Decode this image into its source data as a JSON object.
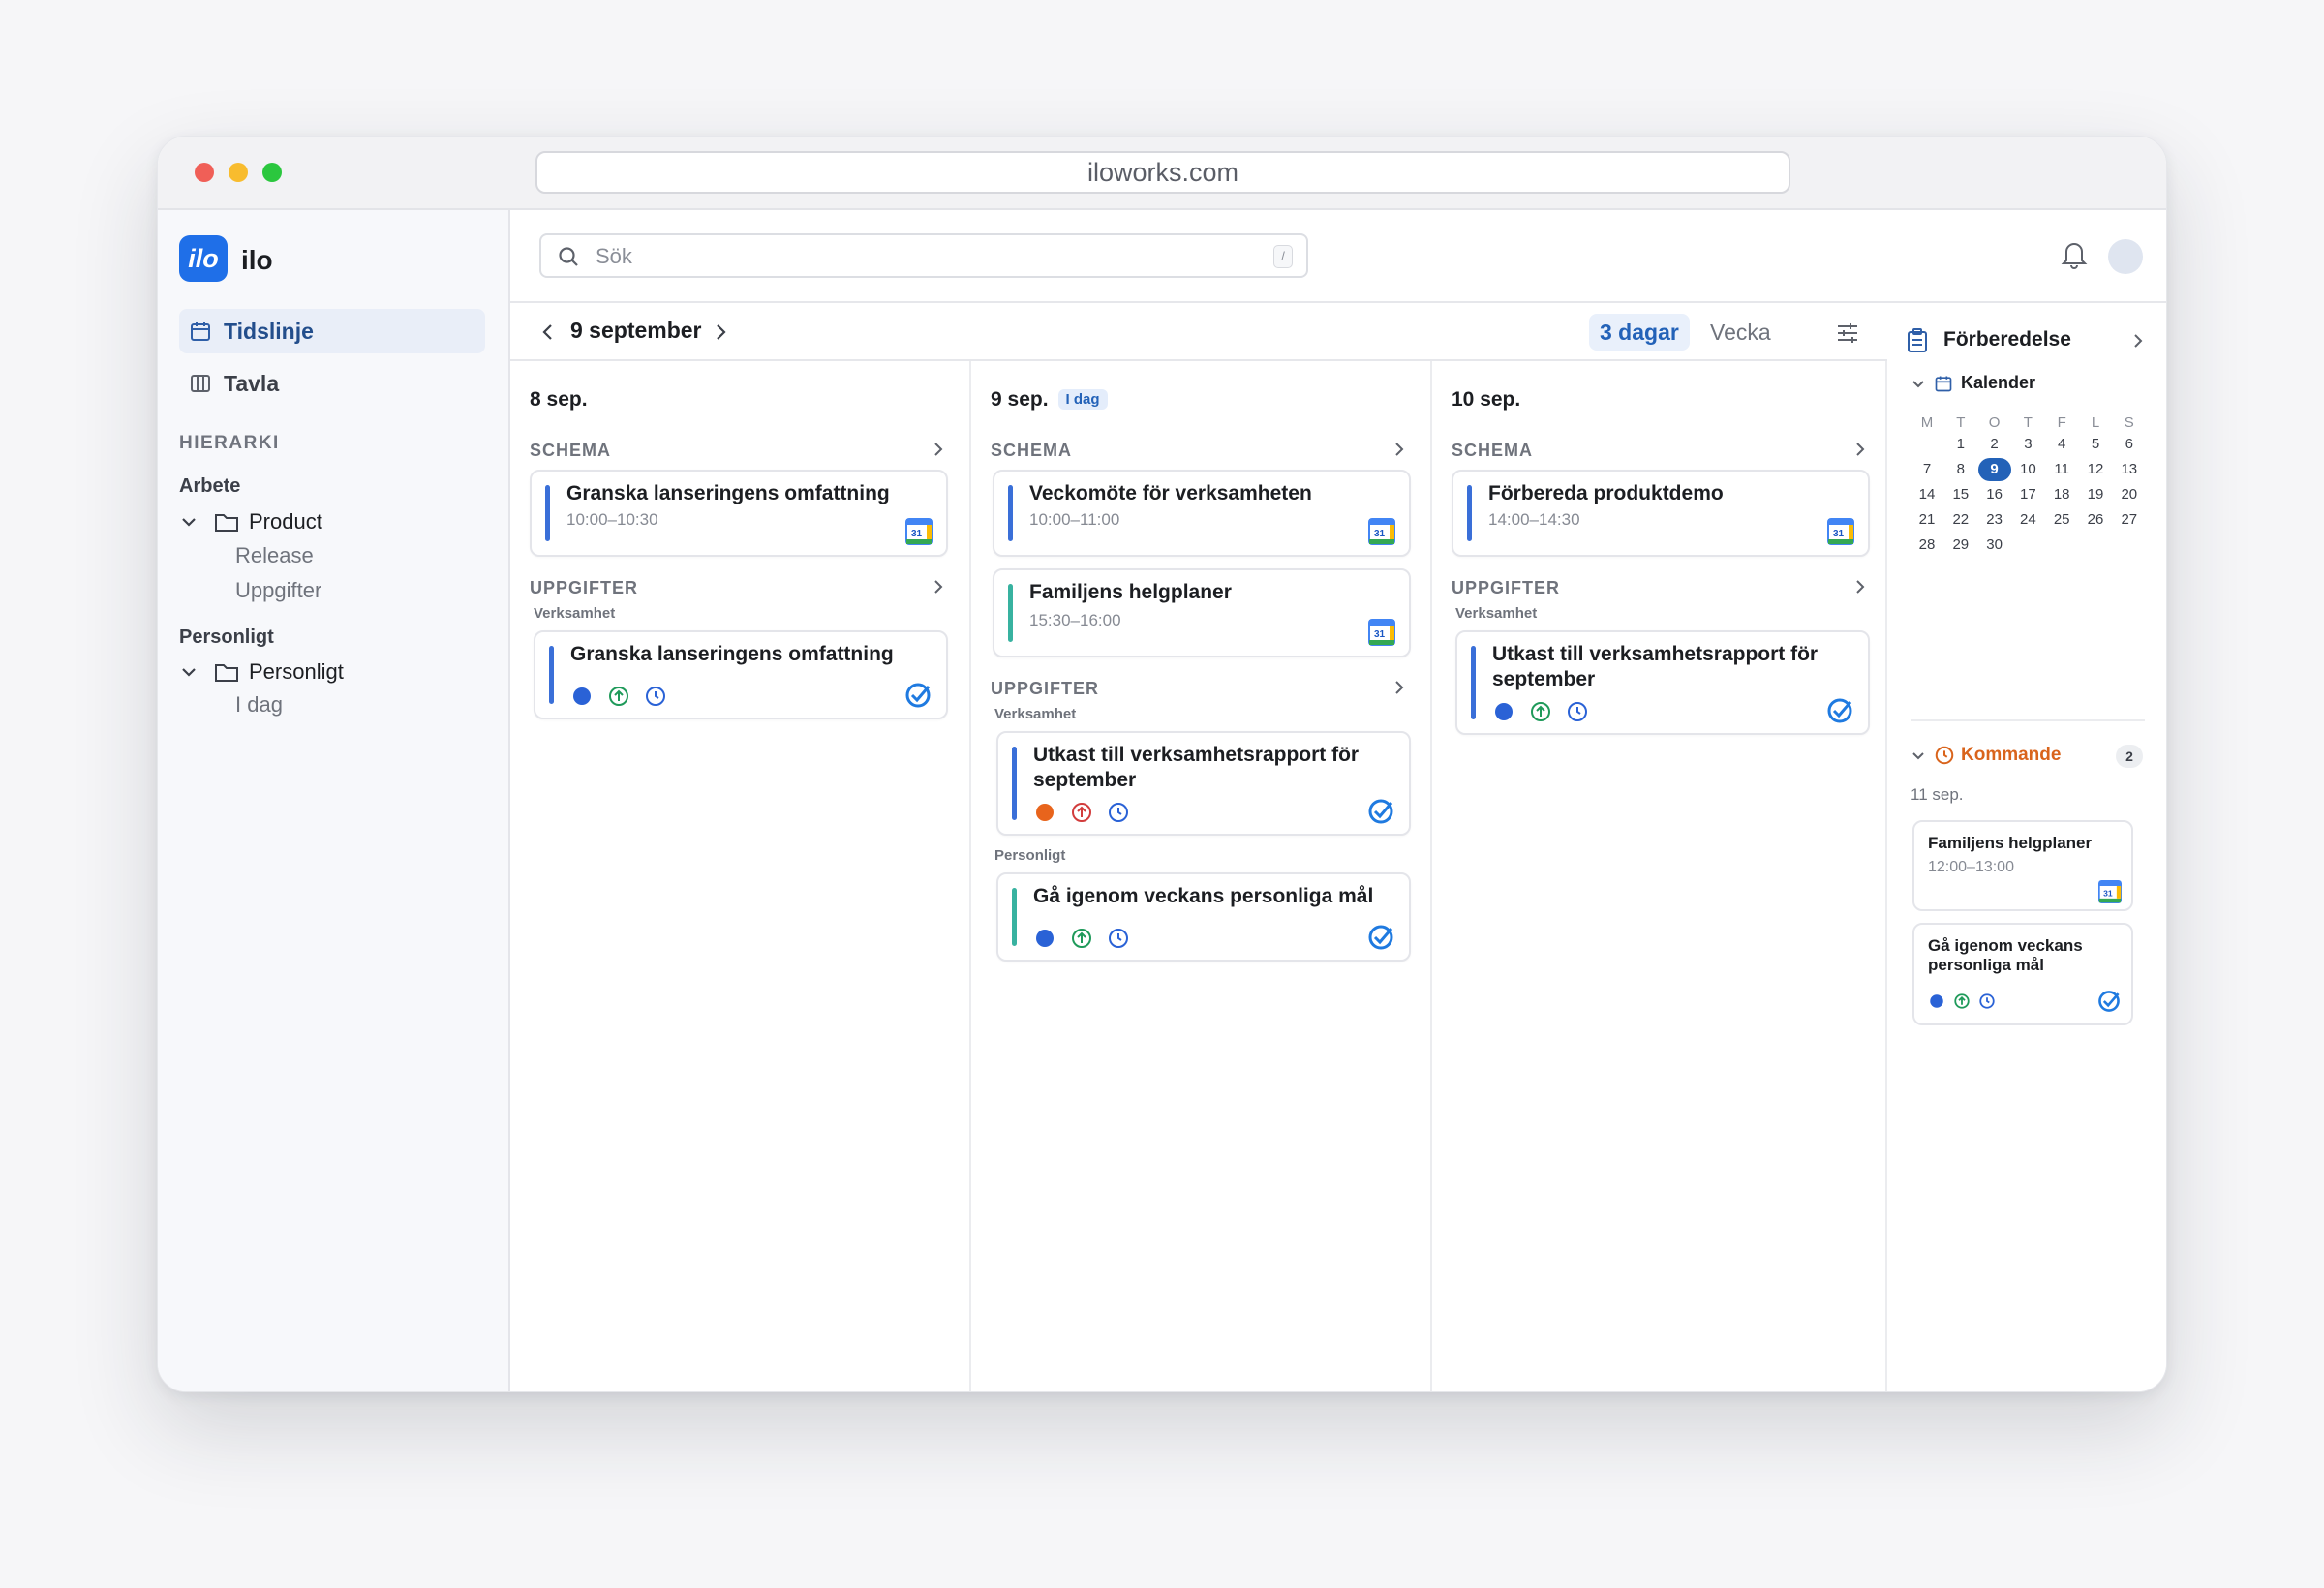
{
  "browser": {
    "url": "iloworks.com"
  },
  "app": {
    "logo_mark": "ilo",
    "name": "ilo"
  },
  "nav": {
    "timeline": "Tidslinje",
    "board": "Tavla"
  },
  "hierarchy": {
    "heading": "HIERARKI",
    "work": {
      "label": "Arbete",
      "folder": "Product",
      "children": [
        "Release",
        "Uppgifter"
      ]
    },
    "personal": {
      "label": "Personligt",
      "folder": "Personligt",
      "children": [
        "I dag"
      ]
    }
  },
  "search": {
    "placeholder": "Sök",
    "shortcut": "/"
  },
  "datebar": {
    "current": "9 september",
    "views": [
      "3 dagar",
      "Vecka"
    ],
    "active_view": "3 dagar"
  },
  "columns": [
    {
      "date": "8 sep.",
      "schedule_heading": "SCHEMA",
      "events": [
        {
          "title": "Granska lanseringens omfattning",
          "time": "10:00–10:30",
          "color": "#3a6fd8"
        }
      ],
      "tasks_heading": "UPPGIFTER",
      "task_groups": [
        {
          "group": "Verksamhet",
          "tasks": [
            {
              "title": "Granska lanseringens omfattning",
              "status": "blue",
              "color": "#3a6fd8"
            }
          ]
        }
      ]
    },
    {
      "date": "9 sep.",
      "today_badge": "I dag",
      "schedule_heading": "SCHEMA",
      "events": [
        {
          "title": "Veckomöte för verksamheten",
          "time": "10:00–11:00",
          "color": "#3a6fd8"
        },
        {
          "title": "Familjens helgplaner",
          "time": "15:30–16:00",
          "color": "#38b2a0"
        }
      ],
      "tasks_heading": "UPPGIFTER",
      "task_groups": [
        {
          "group": "Verksamhet",
          "tasks": [
            {
              "title": "Utkast till verksamhetsrapport för september",
              "status": "orange",
              "color": "#3a6fd8"
            }
          ]
        },
        {
          "group": "Personligt",
          "tasks": [
            {
              "title": "Gå igenom veckans personliga mål",
              "status": "blue",
              "color": "#38b2a0"
            }
          ]
        }
      ]
    },
    {
      "date": "10 sep.",
      "schedule_heading": "SCHEMA",
      "events": [
        {
          "title": "Förbereda produktdemo",
          "time": "14:00–14:30",
          "color": "#3a6fd8"
        }
      ],
      "tasks_heading": "UPPGIFTER",
      "task_groups": [
        {
          "group": "Verksamhet",
          "tasks": [
            {
              "title": "Utkast till verksamhetsrapport för september",
              "status": "blue",
              "color": "#3a6fd8"
            }
          ]
        }
      ]
    }
  ],
  "right_panel": {
    "title": "Förberedelse",
    "calendar_label": "Kalender",
    "weekdays": [
      "M",
      "T",
      "O",
      "T",
      "F",
      "L",
      "S"
    ],
    "days": [
      1,
      2,
      3,
      4,
      5,
      6,
      7,
      8,
      9,
      10,
      11,
      12,
      13,
      14,
      15,
      16,
      17,
      18,
      19,
      20,
      21,
      22,
      23,
      24,
      25,
      26,
      27,
      28,
      29,
      30
    ],
    "first_weekday_offset": 1,
    "selected_day": 9,
    "upcoming_label": "Kommande",
    "upcoming_count": "2",
    "upcoming_date": "11 sep.",
    "upcoming_items": [
      {
        "title": "Familjens helgplaner",
        "time": "12:00–13:00",
        "type": "event"
      },
      {
        "title": "Gå igenom veckans personliga mål",
        "type": "task"
      }
    ]
  },
  "colors": {
    "accent": "#2362b8",
    "blue_status": "#2a62d6",
    "orange_status": "#e8641c",
    "green_priority": "#1f9a5a",
    "red_priority": "#d23c3c",
    "upcoming": "#d9641c"
  },
  "icons": [
    "calendar-icon",
    "board-icon",
    "chevron-down-icon",
    "folder-icon",
    "search-icon",
    "bell-icon",
    "chevron-left-icon",
    "chevron-right-icon",
    "filter-icon",
    "google-calendar-icon",
    "status-dot-icon",
    "priority-up-icon",
    "clock-icon",
    "check-circle-icon",
    "clipboard-icon",
    "clock-orange-icon"
  ]
}
